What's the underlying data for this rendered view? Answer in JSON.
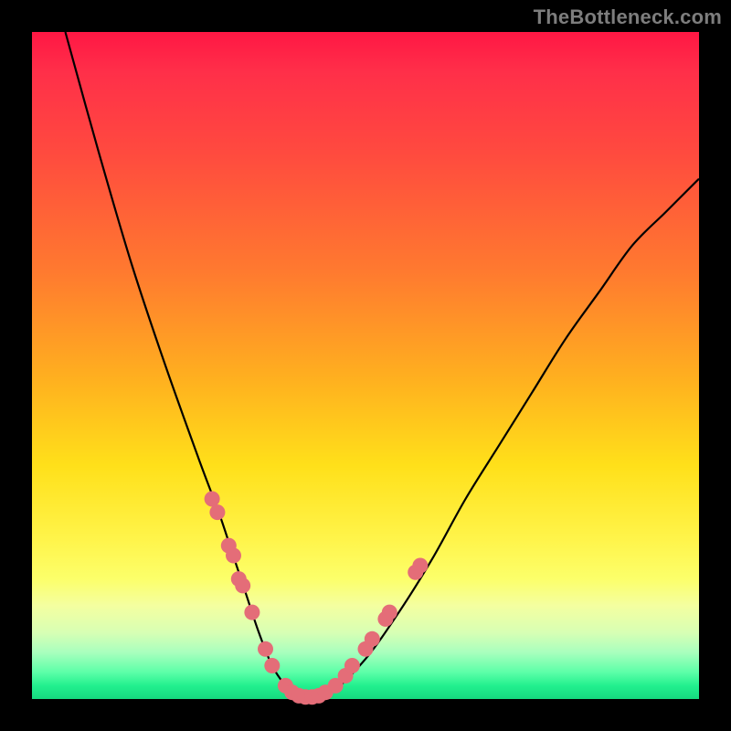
{
  "watermark": "TheBottleneck.com",
  "colors": {
    "frame": "#000000",
    "curve": "#000000",
    "dot": "#e46d78",
    "gradient_top": "#ff1744",
    "gradient_bottom": "#16d97f"
  },
  "chart_data": {
    "type": "line",
    "title": "",
    "xlabel": "",
    "ylabel": "",
    "xlim": [
      0,
      100
    ],
    "ylim": [
      0,
      100
    ],
    "note": "Unlabeled bottleneck curve. x sweeps 0–100 (arbitrary), y = bottleneck % (0 = green/good at bottom, 100 = red/bad at top). Values estimated from pixel positions.",
    "series": [
      {
        "name": "bottleneck-curve",
        "x": [
          5,
          10,
          15,
          20,
          25,
          28,
          30,
          32,
          34,
          36,
          38,
          40,
          42,
          45,
          50,
          55,
          60,
          65,
          70,
          75,
          80,
          85,
          90,
          95,
          100
        ],
        "y": [
          100,
          82,
          65,
          50,
          36,
          28,
          22,
          16,
          10,
          5,
          2,
          0,
          0,
          1,
          6,
          13,
          21,
          30,
          38,
          46,
          54,
          61,
          68,
          73,
          78
        ]
      }
    ],
    "markers": {
      "name": "highlight-dots",
      "note": "Pink dots clustered near the valley on both branches.",
      "points": [
        {
          "x": 27.0,
          "y": 30.0
        },
        {
          "x": 27.8,
          "y": 28.0
        },
        {
          "x": 29.5,
          "y": 23.0
        },
        {
          "x": 30.2,
          "y": 21.5
        },
        {
          "x": 31.0,
          "y": 18.0
        },
        {
          "x": 31.6,
          "y": 17.0
        },
        {
          "x": 33.0,
          "y": 13.0
        },
        {
          "x": 35.0,
          "y": 7.5
        },
        {
          "x": 36.0,
          "y": 5.0
        },
        {
          "x": 38.0,
          "y": 2.0
        },
        {
          "x": 39.0,
          "y": 1.0
        },
        {
          "x": 40.0,
          "y": 0.5
        },
        {
          "x": 41.0,
          "y": 0.3
        },
        {
          "x": 42.0,
          "y": 0.3
        },
        {
          "x": 43.0,
          "y": 0.5
        },
        {
          "x": 44.0,
          "y": 1.0
        },
        {
          "x": 45.5,
          "y": 2.0
        },
        {
          "x": 47.0,
          "y": 3.5
        },
        {
          "x": 48.0,
          "y": 5.0
        },
        {
          "x": 50.0,
          "y": 7.5
        },
        {
          "x": 51.0,
          "y": 9.0
        },
        {
          "x": 53.0,
          "y": 12.0
        },
        {
          "x": 53.6,
          "y": 13.0
        },
        {
          "x": 57.5,
          "y": 19.0
        },
        {
          "x": 58.2,
          "y": 20.0
        }
      ]
    }
  }
}
